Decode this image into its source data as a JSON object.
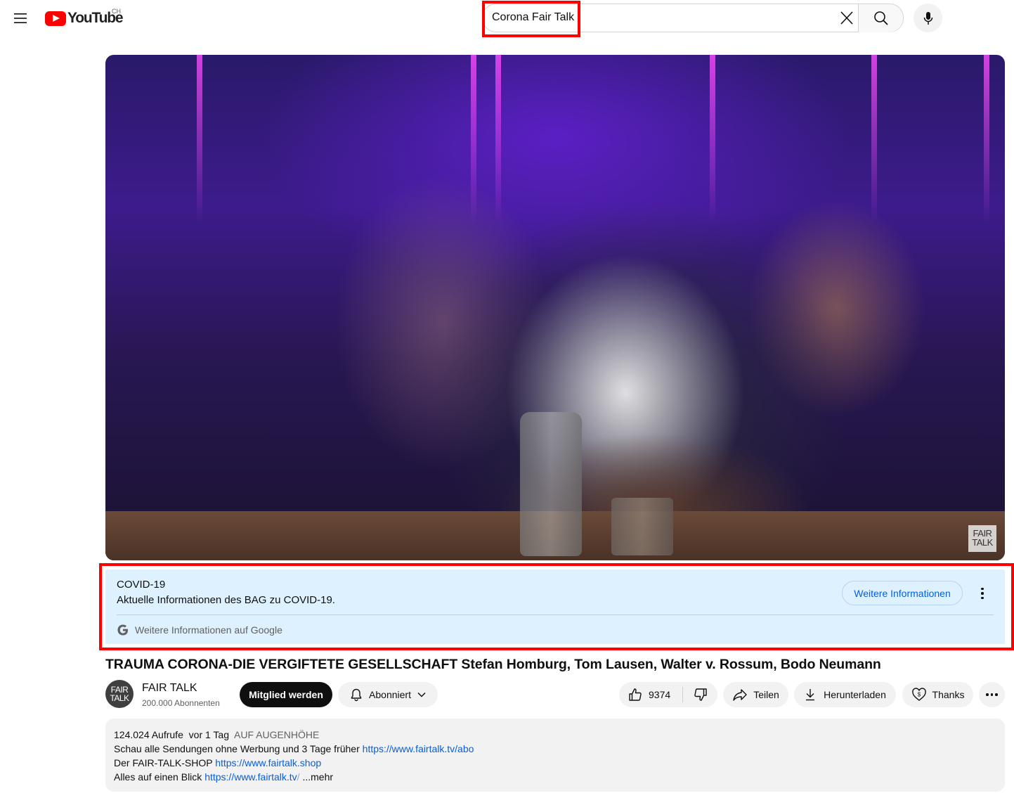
{
  "header": {
    "logo_text": "YouTube",
    "country": "CH",
    "search": {
      "value": "Corona Fair Talk"
    }
  },
  "video": {
    "watermark": "FAIR TALK"
  },
  "info_panel": {
    "title": "COVID-19",
    "subtitle": "Aktuelle Informationen des BAG zu COVID-19.",
    "button_label": "Weitere Informationen",
    "google_link": "Weitere Informationen auf Google"
  },
  "title": "TRAUMA CORONA-DIE VERGIFTETE GESELLSCHAFT Stefan Homburg, Tom Lausen, Walter v. Rossum, Bodo Neumann",
  "channel": {
    "avatar_text": "FAIR TALK",
    "name": "FAIR TALK",
    "subscribers": "200.000 Abonnenten",
    "member_label": "Mitglied werden",
    "subscribed_label": "Abonniert"
  },
  "actions": {
    "likes": "9374",
    "share": "Teilen",
    "download": "Herunterladen",
    "thanks": "Thanks"
  },
  "description": {
    "views": "124.024 Aufrufe",
    "age": "vor 1 Tag",
    "hashtag": "AUF AUGENHÖHE",
    "line1_text": "Schau alle Sendungen ohne Werbung und 3 Tage früher ",
    "line1_link": "https://www.fairtalk.tv/abo",
    "line2_text": "Der FAIR-TALK-SHOP ",
    "line2_link": "https://www.fairtalk.shop",
    "line3_text": "Alles auf einen Blick ",
    "line3_link": "https://www.fairtalk.tv",
    "line3_faded": "/",
    "more": "...mehr"
  },
  "colors": {
    "brand_red": "#ff0000",
    "link_blue": "#065fd4",
    "info_bg": "#def1ff",
    "highlight_red": "#ff0000"
  }
}
